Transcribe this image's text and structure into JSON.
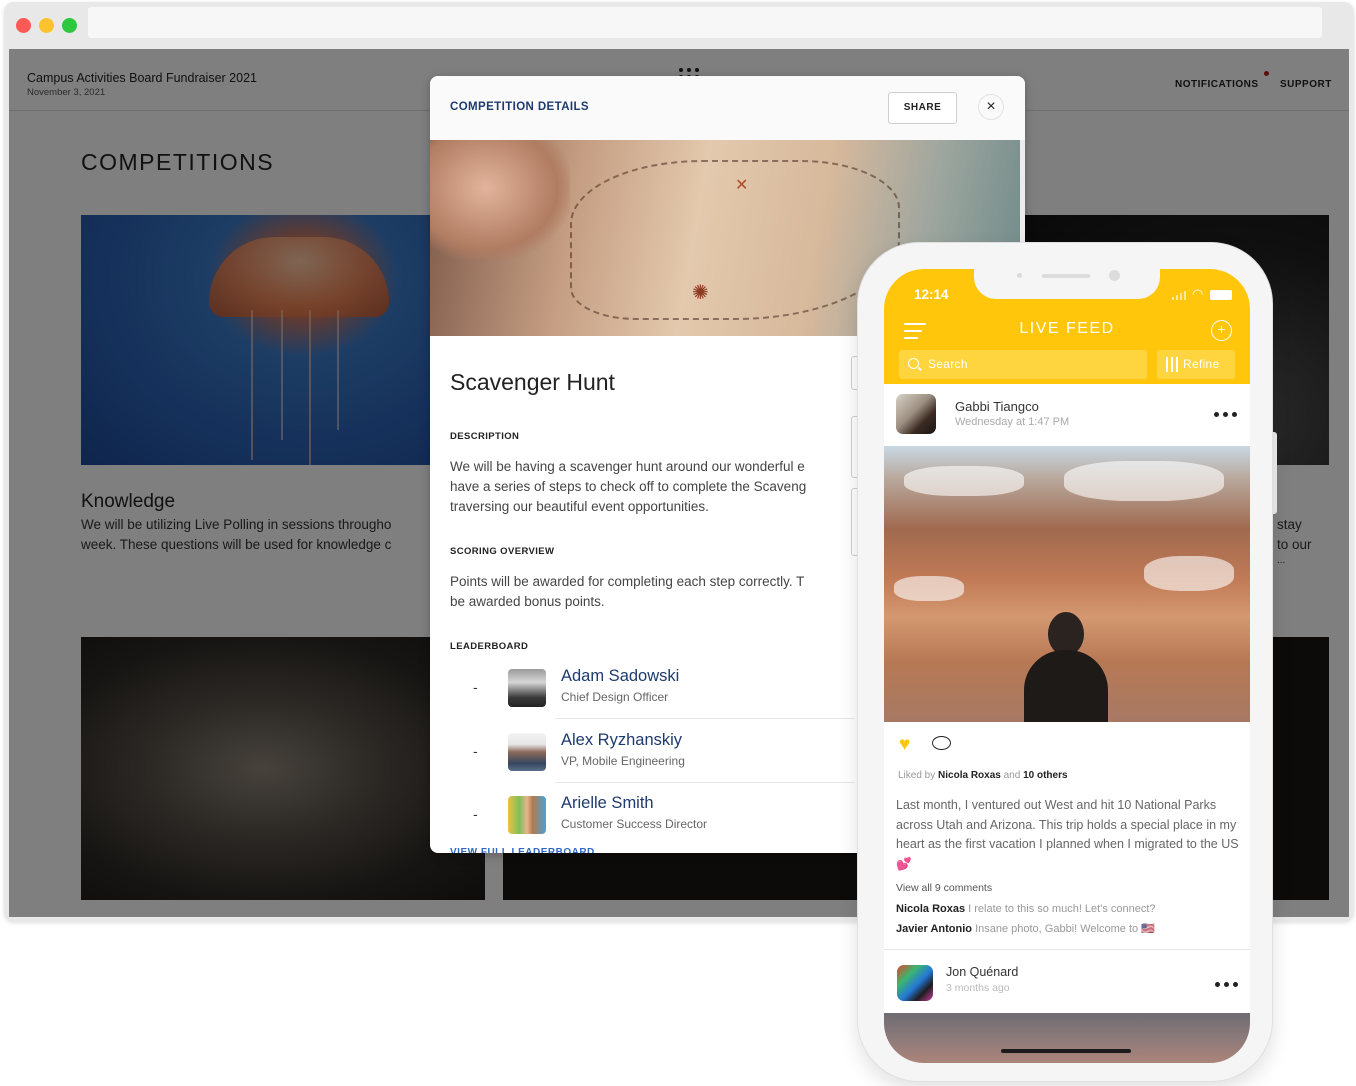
{
  "browser": {
    "window_controls": [
      "close",
      "minimize",
      "maximize"
    ],
    "url": ""
  },
  "header": {
    "event_title": "Campus Activities Board Fundraiser 2021",
    "event_date": "November 3, 2021",
    "nav": {
      "notifications": "NOTIFICATIONS",
      "support": "SUPPORT"
    },
    "notification_badge_color": "#b81c1c"
  },
  "page": {
    "heading": "COMPETITIONS",
    "cards": [
      {
        "title": "Knowledge",
        "description_line1": "We will be utilizing Live Polling in sessions througho",
        "description_line2": "week. These questions will be used for knowledge c"
      },
      {
        "description_line1": "stay",
        "description_line2": "to our",
        "description_line3": "..."
      }
    ]
  },
  "modal": {
    "title": "COMPETITION DETAILS",
    "share_label": "SHARE",
    "close_icon": "×",
    "competition_name": "Scavenger Hunt",
    "description_label": "DESCRIPTION",
    "description_lines": [
      "We will be having a scavenger hunt around our wonderful e",
      "have a series of steps to check off to complete the Scaveng",
      "traversing our beautiful event opportunities."
    ],
    "scoring_label": "SCORING OVERVIEW",
    "scoring_lines": [
      "Points will be awarded for completing each step correctly. T",
      "be awarded bonus points."
    ],
    "leaderboard_label": "LEADERBOARD",
    "leaderboard": [
      {
        "rank": "-",
        "name": "Adam Sadowski",
        "role": "Chief Design Officer"
      },
      {
        "rank": "-",
        "name": "Alex Ryzhanskiy",
        "role": "VP, Mobile Engineering"
      },
      {
        "rank": "-",
        "name": "Arielle Smith",
        "role": "Customer Success Director"
      }
    ],
    "view_full_label": "VIEW FULL LEADERBOARD",
    "accent_color": "#1e3a6e"
  },
  "phone": {
    "time": "12:14",
    "feed_title": "LIVE FEED",
    "add_icon": "+",
    "search_placeholder": "Search",
    "refine_label": "Refine",
    "accent_color": "#ffc60b",
    "posts": [
      {
        "author": "Gabbi Tiangco",
        "time": "Wednesday at 1:47 PM",
        "liked_by_prefix": "Liked by",
        "liked_by_name": "Nicola Roxas",
        "liked_by_and": "and",
        "liked_by_others": "10 others",
        "caption": "Last month, I ventured out West and hit 10 National Parks across Utah and Arizona. This trip holds a special place in my heart as the first vacation I planned when I migrated to the US 💕",
        "view_comments": "View all 9 comments",
        "comments": [
          {
            "author": "Nicola Roxas",
            "text": "I relate to this so much! Let's connect?"
          },
          {
            "author": "Javier Antonio",
            "text": " Insane photo, Gabbi! Welcome to 🇺🇸"
          }
        ]
      },
      {
        "author": "Jon Quénard",
        "time": "3 months ago"
      }
    ]
  }
}
